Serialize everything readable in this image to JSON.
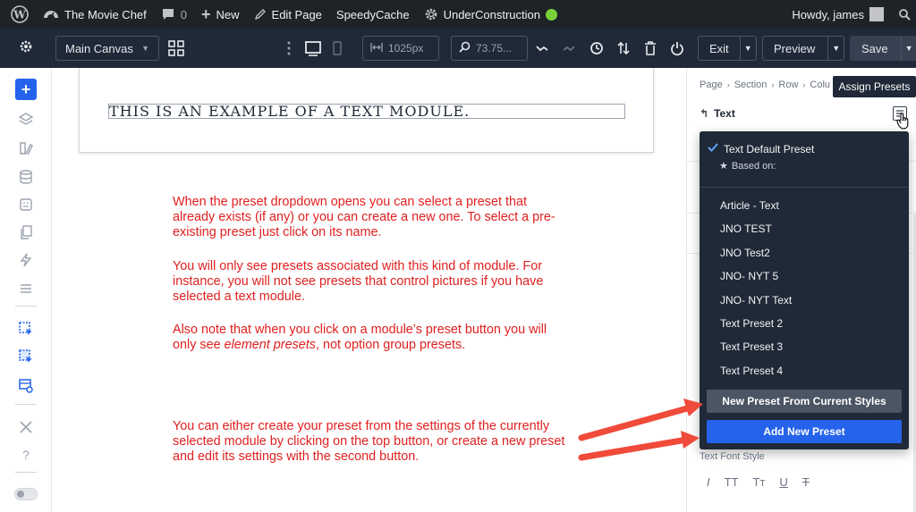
{
  "wpbar": {
    "site_name": "The Movie Chef",
    "comments_count": "0",
    "new_label": "New",
    "edit_page_label": "Edit Page",
    "speedycache_label": "SpeedyCache",
    "under_construction_label": "UnderConstruction",
    "status_color": "#7ad03a",
    "greeting": "Howdy, james"
  },
  "toolbar": {
    "canvas_select": "Main Canvas",
    "width_value": "1025px",
    "zoom_value": "73.75...",
    "exit_label": "Exit",
    "preview_label": "Preview",
    "save_label": "Save"
  },
  "canvas": {
    "module_text": "THIS IS AN EXAMPLE OF A TEXT MODULE.",
    "note1": "When the preset dropdown opens you can select a preset that already exists (if any) or you can create a new one.  To select a pre-existing preset just click on its name.",
    "note2": "You will only see presets associated with this kind of module.  For instance, you will not see presets that control pictures if you have selected a text module.",
    "note3_pre": "Also note that when you click on a module’s preset button you will only see ",
    "note3_em": "element presets",
    "note3_post": ", not option group presets.",
    "note4": "You can either create your preset from the settings of the currently selected module by clicking on the top button, or create a new preset and edit its settings with the second button.",
    "annotation_color": "#e02020"
  },
  "panel": {
    "breadcrumb": [
      "Page",
      "Section",
      "Row",
      "Colu"
    ],
    "tooltip": "Assign Presets",
    "module_title": "Text",
    "font_style_label": "Text Font Style",
    "font_style_buttons": [
      "I",
      "TT",
      "Tт",
      "U",
      "T"
    ]
  },
  "dropdown": {
    "default_preset": "Text Default Preset",
    "based_on": "Based on:",
    "presets": [
      "Article - Text",
      "JNO TEST",
      "JNO Test2",
      "JNO- NYT 5",
      "JNO- NYT Text",
      "Text Preset 2",
      "Text Preset 3",
      "Text Preset 4"
    ],
    "new_from_current": "New Preset From Current Styles",
    "add_new": "Add New Preset",
    "accent_color": "#2563eb"
  }
}
